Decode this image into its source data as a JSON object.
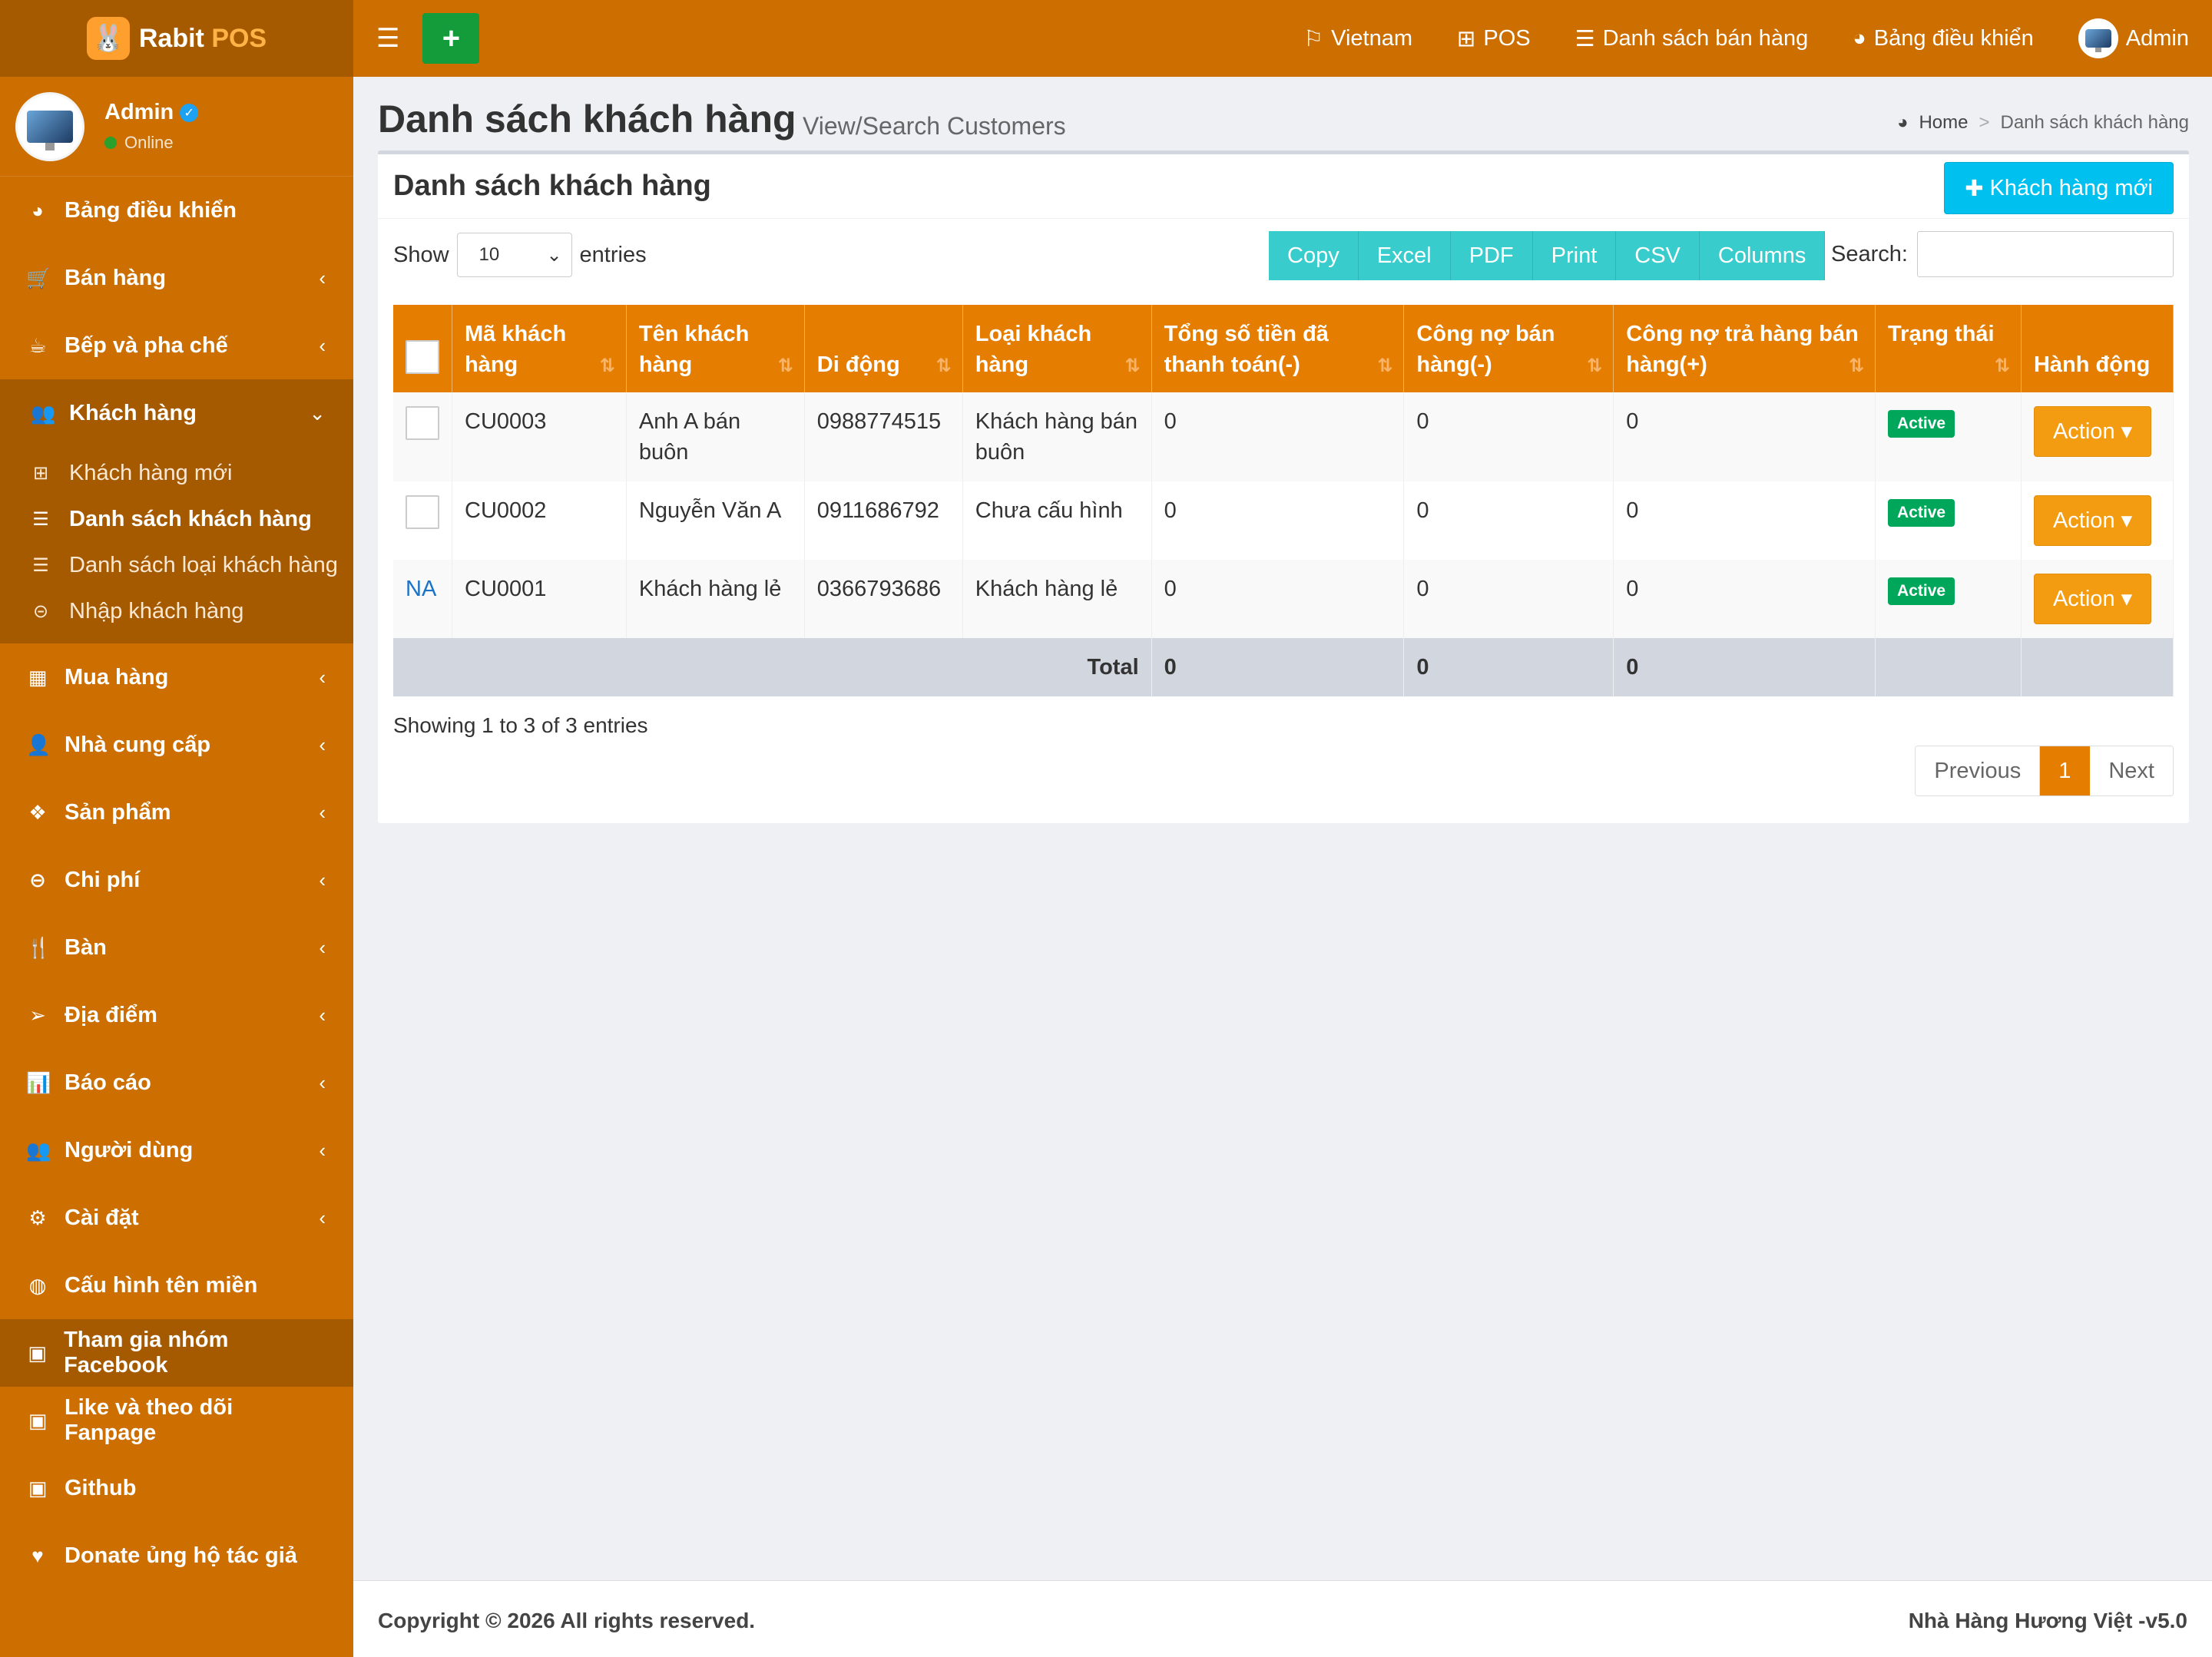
{
  "brand": {
    "name_a": "Rabit ",
    "name_b": "POS",
    "logo_icon": "rabbit-icon"
  },
  "user": {
    "name": "Admin",
    "status": "Online"
  },
  "sidebar": {
    "items": [
      {
        "label": "Bảng điều khiển",
        "icon": "dashboard-icon"
      },
      {
        "label": "Bán hàng",
        "icon": "cart-icon"
      },
      {
        "label": "Bếp và pha chế",
        "icon": "cutlery-icon"
      },
      {
        "label": "Khách hàng",
        "icon": "users-icon"
      },
      {
        "label": "Mua hàng",
        "icon": "grid-icon"
      },
      {
        "label": "Nhà cung cấp",
        "icon": "user-plus-icon"
      },
      {
        "label": "Sản phẩm",
        "icon": "cubes-icon"
      },
      {
        "label": "Chi phí",
        "icon": "minus-circle-icon"
      },
      {
        "label": "Bàn",
        "icon": "fork-knife-icon"
      },
      {
        "label": "Địa điểm",
        "icon": "paper-plane-icon"
      },
      {
        "label": "Báo cáo",
        "icon": "bar-chart-icon"
      },
      {
        "label": "Người dùng",
        "icon": "users-icon"
      },
      {
        "label": "Cài đặt",
        "icon": "cogs-icon"
      },
      {
        "label": "Cấu hình tên miền",
        "icon": "globe-icon"
      },
      {
        "label": "Tham gia nhóm Facebook",
        "icon": "briefcase-icon"
      },
      {
        "label": "Like và theo dõi Fanpage",
        "icon": "briefcase-icon"
      },
      {
        "label": "Github",
        "icon": "briefcase-icon"
      },
      {
        "label": "Donate ủng hộ tác giả",
        "icon": "heart-icon"
      }
    ],
    "submenu": [
      {
        "label": "Khách hàng mới",
        "icon": "plus-square-icon"
      },
      {
        "label": "Danh sách khách hàng",
        "icon": "list-icon"
      },
      {
        "label": "Danh sách loại khách hàng",
        "icon": "list-icon"
      },
      {
        "label": "Nhập khách hàng",
        "icon": "arrow-circle-icon"
      }
    ]
  },
  "topbar": {
    "language": "Vietnam",
    "pos": "POS",
    "sales_list": "Danh sách bán hàng",
    "dashboard": "Bảng điều khiển",
    "admin": "Admin"
  },
  "page": {
    "title": "Danh sách khách hàng",
    "subtitle": "View/Search Customers",
    "breadcrumb_home": "Home",
    "breadcrumb_sep": ">",
    "breadcrumb_current": "Danh sách khách hàng"
  },
  "box": {
    "title": "Danh sách khách hàng",
    "new_button": "Khách hàng mới",
    "show_label": "Show",
    "show_value": "10",
    "entries_label": "entries",
    "search_label": "Search:",
    "export_buttons": [
      "Copy",
      "Excel",
      "PDF",
      "Print",
      "CSV",
      "Columns"
    ]
  },
  "table": {
    "headers": [
      "Mã khách hàng",
      "Tên khách hàng",
      "Di động",
      "Loại khách hàng",
      "Tổng số tiền đã thanh toán(-)",
      "Công nợ bán hàng(-)",
      "Công nợ trả hàng bán hàng(+)",
      "Trạng thái",
      "Hành động"
    ],
    "rows": [
      {
        "select": "",
        "code": "CU0003",
        "name": "Anh A bán buôn",
        "phone": "0988774515",
        "type": "Khách hàng bán buôn",
        "paid": "0",
        "sale_debt": "0",
        "return_debt": "0",
        "status": "Active",
        "action": "Action"
      },
      {
        "select": "",
        "code": "CU0002",
        "name": "Nguyễn Văn A",
        "phone": "0911686792",
        "type": "Chưa cấu hình",
        "paid": "0",
        "sale_debt": "0",
        "return_debt": "0",
        "status": "Active",
        "action": "Action"
      },
      {
        "select": "NA",
        "code": "CU0001",
        "name": "Khách hàng lẻ",
        "phone": "0366793686",
        "type": "Khách hàng lẻ",
        "paid": "0",
        "sale_debt": "0",
        "return_debt": "0",
        "status": "Active",
        "action": "Action"
      }
    ],
    "total_label": "Total",
    "total_paid": "0",
    "total_sale_debt": "0",
    "total_return_debt": "0"
  },
  "pagination": {
    "info": "Showing 1 to 3 of 3 entries",
    "previous": "Previous",
    "current": "1",
    "next": "Next"
  },
  "footer": {
    "copyright": "Copyright © 2026 All rights reserved.",
    "right": "Nhà Hàng Hương Việt -v5.0"
  },
  "colors": {
    "sidebar": "#cc6e00",
    "sidebar_dark": "#a65a00",
    "table_header": "#e57e00",
    "info_button": "#00c0ef",
    "export_button": "#39cccc",
    "action_button": "#f39c12",
    "active_badge": "#00a65a"
  }
}
